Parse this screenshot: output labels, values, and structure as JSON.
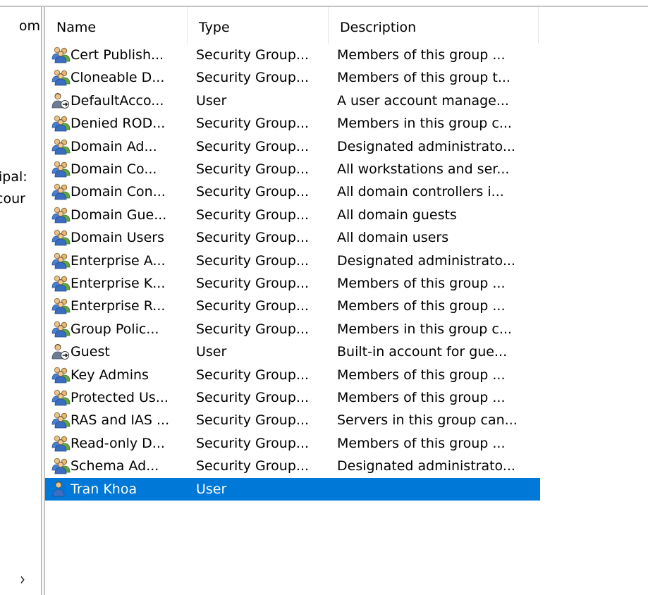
{
  "tree": {
    "items": [
      "om",
      "ipal:",
      "cour"
    ],
    "scroll_arrow": "›"
  },
  "columns": {
    "name": "Name",
    "type": "Type",
    "description": "Description"
  },
  "rows": [
    {
      "name": "Cert Publish...",
      "type": "Security Group...",
      "description": "Members of this group ...",
      "icon": "group-icon"
    },
    {
      "name": "Cloneable D...",
      "type": "Security Group...",
      "description": "Members of this group t...",
      "icon": "group-icon"
    },
    {
      "name": "DefaultAcco...",
      "type": "User",
      "description": "A user account manage...",
      "icon": "disabled-user-icon"
    },
    {
      "name": "Denied ROD...",
      "type": "Security Group...",
      "description": "Members in this group c...",
      "icon": "group-icon"
    },
    {
      "name": "Domain Ad...",
      "type": "Security Group...",
      "description": "Designated administrato...",
      "icon": "group-icon"
    },
    {
      "name": "Domain Co...",
      "type": "Security Group...",
      "description": "All workstations and ser...",
      "icon": "group-icon"
    },
    {
      "name": "Domain Con...",
      "type": "Security Group...",
      "description": "All domain controllers i...",
      "icon": "group-icon"
    },
    {
      "name": "Domain Gue...",
      "type": "Security Group...",
      "description": "All domain guests",
      "icon": "group-icon"
    },
    {
      "name": "Domain Users",
      "type": "Security Group...",
      "description": "All domain users",
      "icon": "group-icon"
    },
    {
      "name": "Enterprise A...",
      "type": "Security Group...",
      "description": "Designated administrato...",
      "icon": "group-icon"
    },
    {
      "name": "Enterprise K...",
      "type": "Security Group...",
      "description": "Members of this group ...",
      "icon": "group-icon"
    },
    {
      "name": "Enterprise R...",
      "type": "Security Group...",
      "description": "Members of this group ...",
      "icon": "group-icon"
    },
    {
      "name": "Group Polic...",
      "type": "Security Group...",
      "description": "Members in this group c...",
      "icon": "group-icon"
    },
    {
      "name": "Guest",
      "type": "User",
      "description": "Built-in account for gue...",
      "icon": "disabled-user-icon"
    },
    {
      "name": "Key Admins",
      "type": "Security Group...",
      "description": "Members of this group ...",
      "icon": "group-icon"
    },
    {
      "name": "Protected Us...",
      "type": "Security Group...",
      "description": "Members of this group ...",
      "icon": "group-icon"
    },
    {
      "name": "RAS and IAS ...",
      "type": "Security Group...",
      "description": "Servers in this group can...",
      "icon": "group-icon"
    },
    {
      "name": "Read-only D...",
      "type": "Security Group...",
      "description": "Members of this group ...",
      "icon": "group-icon"
    },
    {
      "name": "Schema Ad...",
      "type": "Security Group...",
      "description": "Designated administrato...",
      "icon": "group-icon"
    },
    {
      "name": "Tran Khoa",
      "type": "User",
      "description": "",
      "icon": "user-icon",
      "selected": true
    }
  ],
  "colors": {
    "selection": "#0078d7",
    "selection_text": "#ffffff"
  }
}
